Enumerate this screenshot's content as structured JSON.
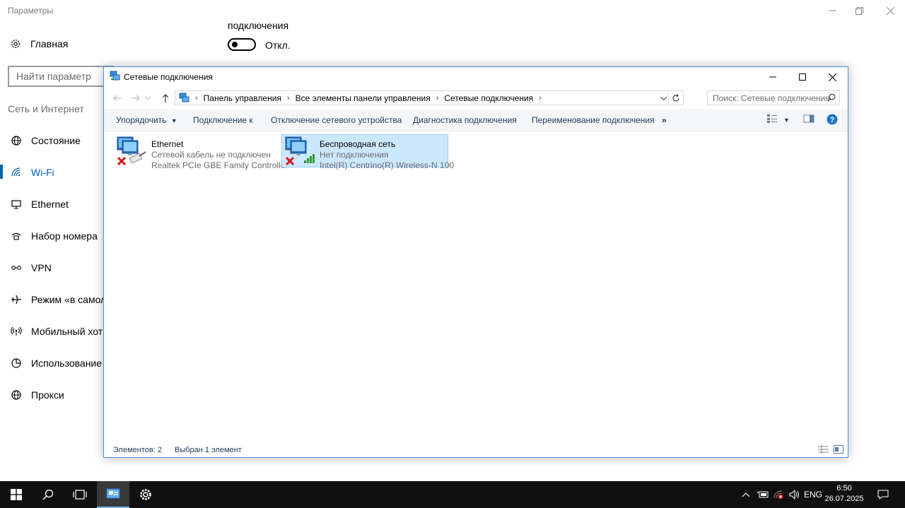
{
  "settings": {
    "window_title": "Параметры",
    "home_label": "Главная",
    "search_placeholder": "Найти параметр",
    "section_title": "Сеть и Интернет",
    "nav_items": [
      {
        "label": "Состояние",
        "icon": "globe-icon"
      },
      {
        "label": "Wi-Fi",
        "icon": "wifi-icon",
        "active": true
      },
      {
        "label": "Ethernet",
        "icon": "ethernet-icon"
      },
      {
        "label": "Набор номера",
        "icon": "dialup-icon"
      },
      {
        "label": "VPN",
        "icon": "vpn-icon"
      },
      {
        "label": "Режим «в самол",
        "icon": "airplane-icon"
      },
      {
        "label": "Мобильный хот",
        "icon": "hotspot-icon"
      },
      {
        "label": "Использование",
        "icon": "data-usage-icon"
      },
      {
        "label": "Прокси",
        "icon": "proxy-globe-icon"
      }
    ],
    "connection_label": "подключения",
    "toggle_state_label": "Откл.",
    "accent_color": "#0063b1"
  },
  "explorer": {
    "title": "Сетевые подключения",
    "breadcrumbs": [
      "Панель управления",
      "Все элементы панели управления",
      "Сетевые подключения"
    ],
    "search_placeholder": "Поиск: Сетевые подключения",
    "commands": [
      "Упорядочить",
      "Подключение к",
      "Отключение сетевого устройства",
      "Диагностика подключения",
      "Переименование подключения"
    ],
    "more_label": "»",
    "items": [
      {
        "name": "Ethernet",
        "status": "Сетевой кабель не подключен",
        "device": "Realtek PCIe GBE Family Controller",
        "selected": false
      },
      {
        "name": "Беспроводная сеть",
        "status": "Нет подключения",
        "device": "Intel(R) Centrino(R) Wireless-N 100",
        "selected": true
      }
    ],
    "status_count": "Элементов: 2",
    "status_selected": "Выбран 1 элемент",
    "selection_color": "#cce8ff"
  },
  "taskbar": {
    "language": "ENG",
    "time": "6:50",
    "date": "26.07.2025"
  }
}
